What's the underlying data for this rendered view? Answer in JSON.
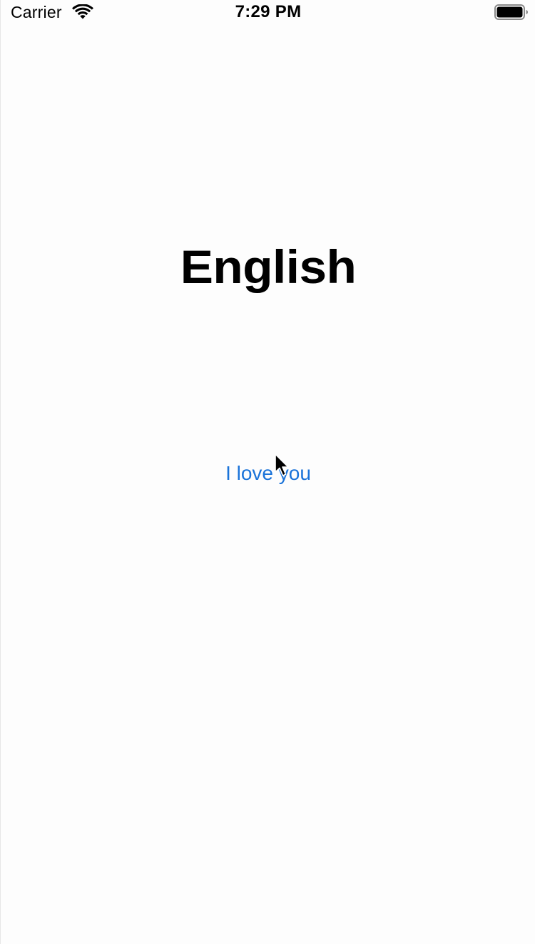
{
  "status_bar": {
    "carrier": "Carrier",
    "time": "7:29 PM",
    "wifi_icon": "wifi-icon",
    "battery_icon": "battery-icon"
  },
  "main": {
    "title": "English",
    "phrase_button_label": "I love you"
  },
  "colors": {
    "link": "#1a73d9",
    "background": "#fdfdfd",
    "text": "#000000"
  }
}
